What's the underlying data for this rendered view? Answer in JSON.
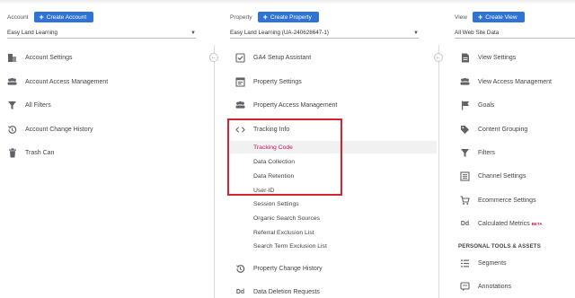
{
  "account": {
    "label": "Account",
    "create_label": "Create Account",
    "selected": "Easy Land Learning",
    "items": [
      {
        "label": "Account Settings",
        "icon": "building-icon"
      },
      {
        "label": "Account Access Management",
        "icon": "people-icon"
      },
      {
        "label": "All Filters",
        "icon": "filter-icon"
      },
      {
        "label": "Account Change History",
        "icon": "history-icon"
      },
      {
        "label": "Trash Can",
        "icon": "trash-icon"
      }
    ]
  },
  "property": {
    "label": "Property",
    "create_label": "Create Property",
    "selected": "Easy Land Learning (UA-240628647-1)",
    "items": [
      {
        "label": "GA4 Setup Assistant",
        "icon": "checkbox-icon"
      },
      {
        "label": "Property Settings",
        "icon": "settings-window-icon"
      },
      {
        "label": "Property Access Management",
        "icon": "people-icon"
      },
      {
        "label": "Tracking Info",
        "icon": "code-icon"
      }
    ],
    "tracking_subitems": [
      "Tracking Code",
      "Data Collection",
      "Data Retention",
      "User-ID",
      "Session Settings",
      "Organic Search Sources",
      "Referral Exclusion List",
      "Search Term Exclusion List"
    ],
    "after_items": [
      {
        "label": "Property Change History",
        "icon": "history-icon"
      },
      {
        "label": "Data Deletion Requests",
        "icon": "dd-icon"
      }
    ]
  },
  "view": {
    "label": "View",
    "create_label": "Create View",
    "selected": "All Web Site Data",
    "items": [
      {
        "label": "View Settings",
        "icon": "document-icon"
      },
      {
        "label": "View Access Management",
        "icon": "people-icon"
      },
      {
        "label": "Goals",
        "icon": "flag-icon"
      },
      {
        "label": "Content Grouping",
        "icon": "tag-icon"
      },
      {
        "label": "Filters",
        "icon": "filter-icon"
      },
      {
        "label": "Channel Settings",
        "icon": "channel-icon"
      },
      {
        "label": "Ecommerce Settings",
        "icon": "cart-icon"
      },
      {
        "label": "Calculated Metrics",
        "icon": "dd-icon",
        "badge": "BETA"
      }
    ],
    "section_heading": "PERSONAL TOOLS & ASSETS",
    "personal_items": [
      {
        "label": "Segments",
        "icon": "segments-icon"
      },
      {
        "label": "Annotations",
        "icon": "annotation-icon"
      }
    ]
  },
  "collapse_glyph": "←",
  "colors": {
    "accent": "#2f73d4",
    "active_link": "#c2185b",
    "highlight_border": "#d62331"
  }
}
